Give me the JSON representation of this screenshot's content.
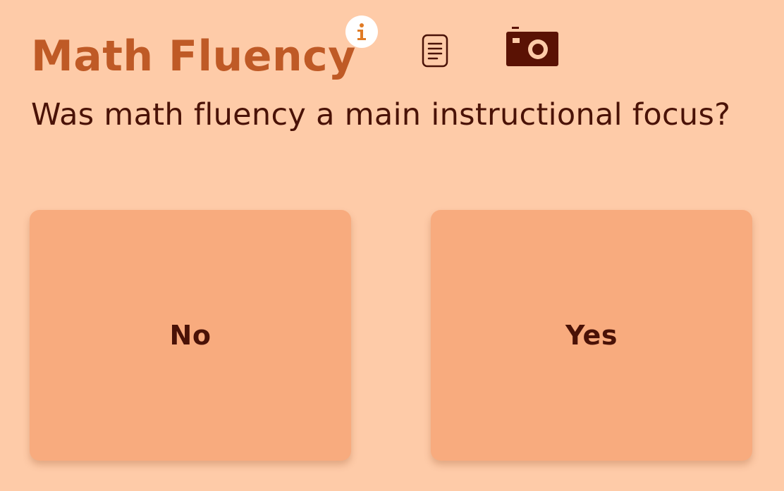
{
  "header": {
    "title": "Math Fluency",
    "icons": {
      "info": "info-icon",
      "notes": "notes-icon",
      "camera": "camera-icon"
    }
  },
  "question": {
    "text": "Was math fluency a main instructional focus?"
  },
  "choices": [
    {
      "label": "No"
    },
    {
      "label": "Yes"
    }
  ],
  "colors": {
    "background": "#fecba8",
    "title": "#bf5a26",
    "text": "#4a1207",
    "choice_background": "#f8ab7e",
    "info_accent": "#e07b25"
  }
}
